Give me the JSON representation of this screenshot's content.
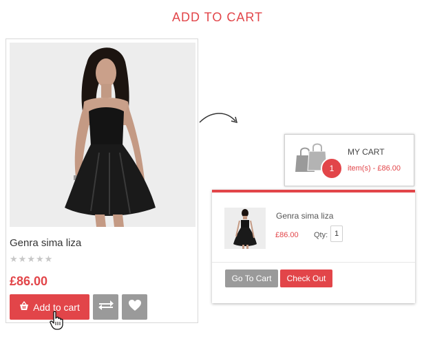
{
  "heading": "ADD TO CART",
  "product": {
    "name": "Genra sima liza",
    "rating": 0,
    "rating_max": 5,
    "price": "£86.00",
    "add_to_cart_label": "Add to cart",
    "icons": {
      "basket": "basket-icon",
      "compare": "compare-arrows-icon",
      "wishlist": "heart-icon"
    }
  },
  "minicart": {
    "title": "MY CART",
    "count": "1",
    "summary": "item(s) - £86.00",
    "icon": "shopping-bags-icon"
  },
  "dropdown": {
    "item_name": "Genra sima liza",
    "item_price": "£86.00",
    "qty_label": "Qty:",
    "qty_value": "1",
    "go_to_cart_label": "Go To Cart",
    "checkout_label": "Check Out"
  },
  "colors": {
    "accent": "#e24549",
    "gray_button": "#9a9a9a",
    "photo_bg": "#ededed"
  }
}
